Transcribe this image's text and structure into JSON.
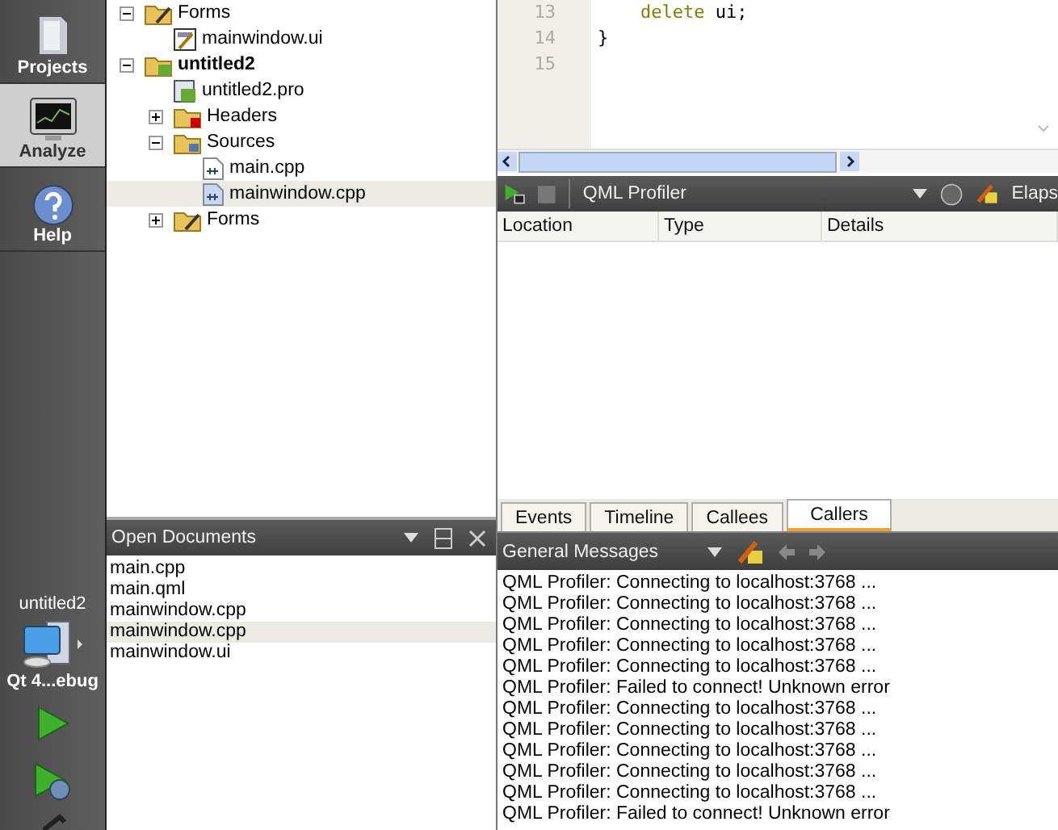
{
  "mode_bar": {
    "modes": [
      {
        "label": "Projects",
        "kind": "projects",
        "selected": false
      },
      {
        "label": "Analyze",
        "kind": "analyze",
        "selected": true
      },
      {
        "label": "Help",
        "kind": "help",
        "selected": false
      }
    ],
    "target": {
      "project": "untitled2",
      "config": "Qt 4...ebug"
    }
  },
  "project_tree": [
    {
      "label": "Forms",
      "kind": "forms",
      "expanded": true,
      "selected": false,
      "children": [
        {
          "label": "mainwindow.ui",
          "kind": "ui",
          "selected": false
        }
      ]
    },
    {
      "label": "untitled2",
      "kind": "project",
      "expanded": true,
      "selected": false,
      "children": [
        {
          "label": "untitled2.pro",
          "kind": "pro",
          "selected": false
        },
        {
          "label": "Headers",
          "kind": "headers",
          "expanded": false,
          "selected": false
        },
        {
          "label": "Sources",
          "kind": "sources",
          "expanded": true,
          "selected": false,
          "children": [
            {
              "label": "main.cpp",
              "kind": "cpp",
              "selected": false
            },
            {
              "label": "mainwindow.cpp",
              "kind": "cpp",
              "selected": true
            }
          ]
        },
        {
          "label": "Forms",
          "kind": "forms",
          "expanded": false,
          "selected": false
        }
      ]
    }
  ],
  "open_documents": {
    "title": "Open Documents",
    "items": [
      {
        "label": "main.cpp",
        "selected": false
      },
      {
        "label": "main.qml",
        "selected": false
      },
      {
        "label": "mainwindow.cpp",
        "selected": false
      },
      {
        "label": "mainwindow.cpp",
        "selected": true
      },
      {
        "label": "mainwindow.ui",
        "selected": false
      }
    ]
  },
  "editor": {
    "lines": [
      {
        "number": "13",
        "tokens": [
          {
            "text": "    delete",
            "kind": "keyword"
          },
          {
            "text": " ui;",
            "kind": "plain"
          }
        ]
      },
      {
        "number": "14",
        "tokens": [
          {
            "text": "}",
            "kind": "plain"
          }
        ]
      },
      {
        "number": "15"
      }
    ]
  },
  "profiler": {
    "tool": "QML Profiler",
    "elapsed_label": "Elaps",
    "columns": [
      "Location",
      "Type",
      "Details"
    ],
    "tabs": [
      {
        "label": "Events",
        "selected": false
      },
      {
        "label": "Timeline",
        "selected": false
      },
      {
        "label": "Callees",
        "selected": false
      },
      {
        "label": "Callers",
        "selected": true
      }
    ]
  },
  "output": {
    "pane": "General Messages",
    "messages": [
      "QML Profiler: Connecting to localhost:3768 ...",
      "QML Profiler: Connecting to localhost:3768 ...",
      "QML Profiler: Connecting to localhost:3768 ...",
      "QML Profiler: Connecting to localhost:3768 ...",
      "QML Profiler: Connecting to localhost:3768 ...",
      "QML Profiler: Failed to connect! Unknown error",
      "QML Profiler: Connecting to localhost:3768 ...",
      "QML Profiler: Connecting to localhost:3768 ...",
      "QML Profiler: Connecting to localhost:3768 ...",
      "QML Profiler: Connecting to localhost:3768 ...",
      "QML Profiler: Connecting to localhost:3768 ...",
      "QML Profiler: Failed to connect! Unknown error"
    ]
  }
}
